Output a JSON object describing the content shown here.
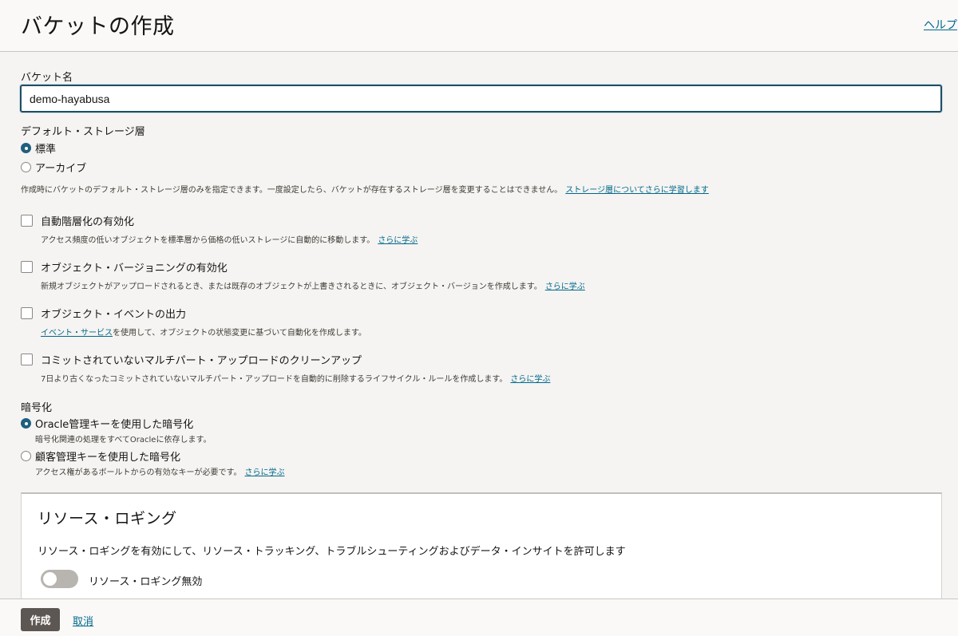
{
  "header": {
    "title": "バケットの作成",
    "help_label": "ヘルプ"
  },
  "bucket_name": {
    "label": "バケット名",
    "value": "demo-hayabusa"
  },
  "storage_tier": {
    "label": "デフォルト・ストレージ層",
    "options": [
      {
        "label": "標準",
        "selected": true
      },
      {
        "label": "アーカイブ",
        "selected": false
      }
    ],
    "help": "作成時にバケットのデフォルト・ストレージ層のみを指定できます。一度設定したら、バケットが存在するストレージ層を変更することはできません。",
    "help_link": "ストレージ層についてさらに学習します"
  },
  "options": [
    {
      "label": "自動階層化の有効化",
      "help_before": "アクセス頻度の低いオブジェクトを標準層から価格の低いストレージに自動的に移動します。",
      "link": "さらに学ぶ",
      "help_after": "",
      "checked": false
    },
    {
      "label": "オブジェクト・バージョニングの有効化",
      "help_before": "新規オブジェクトがアップロードされるとき、または既存のオブジェクトが上書きされるときに、オブジェクト・バージョンを作成します。",
      "link": "さらに学ぶ",
      "help_after": "",
      "checked": false
    },
    {
      "label": "オブジェクト・イベントの出力",
      "help_before": "",
      "link": "イベント・サービス",
      "help_after": "を使用して、オブジェクトの状態変更に基づいて自動化を作成します。",
      "checked": false
    },
    {
      "label": "コミットされていないマルチパート・アップロードのクリーンアップ",
      "help_before": "7日より古くなったコミットされていないマルチパート・アップロードを自動的に削除するライフサイクル・ルールを作成します。",
      "link": "さらに学ぶ",
      "help_after": "",
      "checked": false
    }
  ],
  "encryption": {
    "label": "暗号化",
    "options": [
      {
        "label": "Oracle管理キーを使用した暗号化",
        "help": "暗号化関連の処理をすべてOracleに依存します。",
        "link": "",
        "selected": true
      },
      {
        "label": "顧客管理キーを使用した暗号化",
        "help": "アクセス権があるボールトからの有効なキーが必要です。",
        "link": "さらに学ぶ",
        "selected": false
      }
    ]
  },
  "resource_logging": {
    "title": "リソース・ロギング",
    "description": "リソース・ロギングを有効にして、リソース・トラッキング、トラブルシューティングおよびデータ・インサイトを許可します",
    "toggle_label": "リソース・ロギング無効",
    "enabled": false
  },
  "footer": {
    "create_label": "作成",
    "cancel_label": "取消"
  }
}
